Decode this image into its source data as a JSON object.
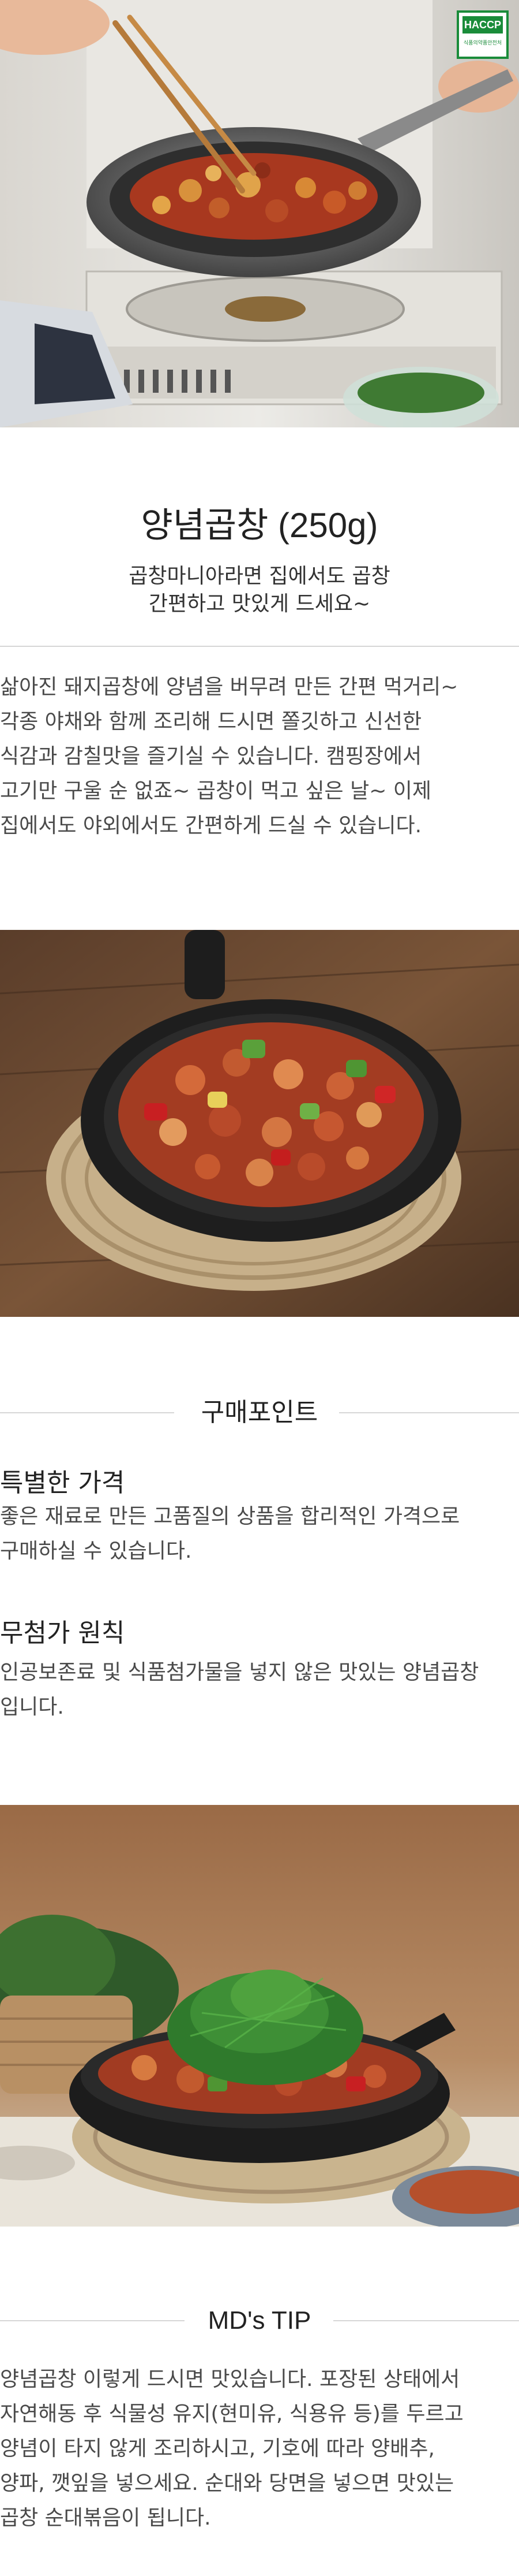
{
  "hero": {
    "badge_title": "HACCP",
    "badge_sub": "식품의약품안전처"
  },
  "product": {
    "name": "양념곱창 (250g)",
    "subtitle_lines": [
      "곱창마니아라면 집에서도 곱창",
      "간편하고 맛있게 드세요~"
    ]
  },
  "description_lines": [
    "삶아진 돼지곱창에 양념을 버무려 만든 간편 먹거리~",
    "각종 야채와 함께 조리해 드시면 쫄깃하고 신선한",
    "식감과 감칠맛을 즐기실 수 있습니다. 캠핑장에서",
    "고기만 구울 순 없죠~ 곱창이 먹고 싶은 날~ 이제",
    "집에서도 야외에서도 간편하게 드실 수 있습니다."
  ],
  "purchase_points": {
    "title": "구매포인트",
    "items": [
      {
        "heading": "특별한 가격",
        "lines": [
          "좋은 재료로 만든 고품질의 상품을 합리적인 가격으로",
          "구매하실 수 있습니다."
        ]
      },
      {
        "heading": "무첨가 원칙",
        "lines": [
          "인공보존료 및 식품첨가물을 넣지 않은 맛있는 양념곱창",
          "입니다."
        ]
      }
    ]
  },
  "md_tip": {
    "title": "MD's TIP",
    "lines": [
      "양념곱창 이렇게 드시면 맛있습니다. 포장된 상태에서",
      "자연해동 후 식물성 유지(현미유, 식용유 등)를 두르고",
      "양념이 타지 않게 조리하시고, 기호에 따라 양배추,",
      "양파, 깻잎을 넣으세요. 순대와 당면을 넣으면 맛있는",
      "곱창 순대볶음이 됩니다."
    ]
  },
  "colors": {
    "badge_green": "#1a8c3a",
    "sauce_red": "#a8381f",
    "wood_brown": "#6b4a33",
    "text_gray": "#4a4a4a"
  }
}
